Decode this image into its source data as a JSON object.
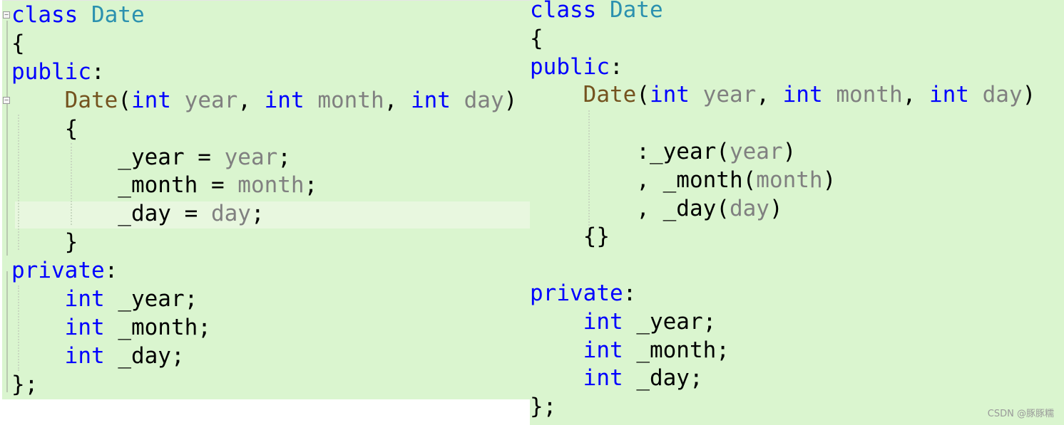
{
  "left_panel": {
    "lines": [
      [
        [
          "class ",
          "kw"
        ],
        [
          "Date",
          "ty"
        ]
      ],
      [
        [
          "{",
          ""
        ]
      ],
      [
        [
          "public",
          "kw"
        ],
        [
          ":",
          ""
        ]
      ],
      [
        [
          "    ",
          ""
        ],
        [
          "Date",
          "fn"
        ],
        [
          "(",
          ""
        ],
        [
          "int",
          "kw"
        ],
        [
          " ",
          ""
        ],
        [
          "year",
          "pa"
        ],
        [
          ", ",
          ""
        ],
        [
          "int",
          "kw"
        ],
        [
          " ",
          ""
        ],
        [
          "month",
          "pa"
        ],
        [
          ", ",
          ""
        ],
        [
          "int",
          "kw"
        ],
        [
          " ",
          ""
        ],
        [
          "day",
          "pa"
        ],
        [
          ")",
          ""
        ]
      ],
      [
        [
          "    {",
          ""
        ]
      ],
      [
        [
          "        _year = ",
          ""
        ],
        [
          "year",
          "pa"
        ],
        [
          ";",
          ""
        ]
      ],
      [
        [
          "        _month = ",
          ""
        ],
        [
          "month",
          "pa"
        ],
        [
          ";",
          ""
        ]
      ],
      [
        [
          "        _day = ",
          ""
        ],
        [
          "day",
          "pa"
        ],
        [
          ";",
          ""
        ]
      ],
      [
        [
          "    }",
          ""
        ]
      ],
      [
        [
          "private",
          "kw"
        ],
        [
          ":",
          ""
        ]
      ],
      [
        [
          "    ",
          ""
        ],
        [
          "int",
          "kw"
        ],
        [
          " _year;",
          ""
        ]
      ],
      [
        [
          "    ",
          ""
        ],
        [
          "int",
          "kw"
        ],
        [
          " _month;",
          ""
        ]
      ],
      [
        [
          "    ",
          ""
        ],
        [
          "int",
          "kw"
        ],
        [
          " _day;",
          ""
        ]
      ],
      [
        [
          "};",
          ""
        ]
      ]
    ]
  },
  "right_panel": {
    "lines": [
      [
        [
          "class ",
          "kw"
        ],
        [
          "Date",
          "ty"
        ]
      ],
      [
        [
          "{",
          ""
        ]
      ],
      [
        [
          "public",
          "kw"
        ],
        [
          ":",
          ""
        ]
      ],
      [
        [
          "    ",
          ""
        ],
        [
          "Date",
          "fn"
        ],
        [
          "(",
          ""
        ],
        [
          "int",
          "kw"
        ],
        [
          " ",
          ""
        ],
        [
          "year",
          "pa"
        ],
        [
          ", ",
          ""
        ],
        [
          "int",
          "kw"
        ],
        [
          " ",
          ""
        ],
        [
          "month",
          "pa"
        ],
        [
          ", ",
          ""
        ],
        [
          "int",
          "kw"
        ],
        [
          " ",
          ""
        ],
        [
          "day",
          "pa"
        ],
        [
          ")",
          ""
        ]
      ],
      [],
      [
        [
          "        :_year(",
          ""
        ],
        [
          "year",
          "pa"
        ],
        [
          ")",
          ""
        ]
      ],
      [
        [
          "        , _month(",
          ""
        ],
        [
          "month",
          "pa"
        ],
        [
          ")",
          ""
        ]
      ],
      [
        [
          "        , _day(",
          ""
        ],
        [
          "day",
          "pa"
        ],
        [
          ")",
          ""
        ]
      ],
      [
        [
          "    {}",
          ""
        ]
      ],
      [],
      [
        [
          "private",
          "kw"
        ],
        [
          ":",
          ""
        ]
      ],
      [
        [
          "    ",
          ""
        ],
        [
          "int",
          "kw"
        ],
        [
          " _year;",
          ""
        ]
      ],
      [
        [
          "    ",
          ""
        ],
        [
          "int",
          "kw"
        ],
        [
          " _month;",
          ""
        ]
      ],
      [
        [
          "    ",
          ""
        ],
        [
          "int",
          "kw"
        ],
        [
          " _day;",
          ""
        ]
      ],
      [
        [
          "};",
          ""
        ]
      ]
    ]
  },
  "watermark": "CSDN @豚豚糯",
  "colors": {
    "background": "#daf5cf",
    "keyword": "#0000ff",
    "type": "#2b91af",
    "function": "#74531f",
    "parameter": "#808080"
  }
}
